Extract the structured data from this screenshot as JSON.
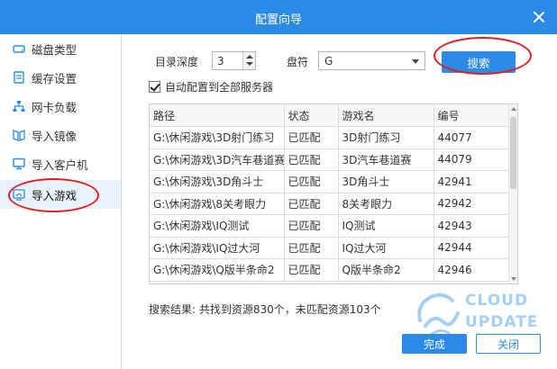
{
  "window": {
    "title": "配置向导"
  },
  "sidebar": {
    "items": [
      {
        "label": "磁盘类型",
        "icon": "disk-icon"
      },
      {
        "label": "缓存设置",
        "icon": "cache-icon"
      },
      {
        "label": "网卡负载",
        "icon": "network-icon"
      },
      {
        "label": "导入镜像",
        "icon": "mirror-icon"
      },
      {
        "label": "导入客户机",
        "icon": "monitor-icon"
      },
      {
        "label": "导入游戏",
        "icon": "game-icon",
        "active": true
      }
    ]
  },
  "form": {
    "depth_label": "目录深度",
    "depth_value": "3",
    "drive_label": "盘符",
    "drive_value": "G",
    "search_button": "搜索",
    "auto_config_label": "自动配置到全部服务器",
    "auto_config_checked": true
  },
  "table": {
    "headers": [
      "路径",
      "状态",
      "游戏名",
      "编号"
    ],
    "rows": [
      [
        "G:\\休闲游戏\\3D射门练习",
        "已匹配",
        "3D射门练习",
        "44077"
      ],
      [
        "G:\\休闲游戏\\3D汽车巷道赛",
        "已匹配",
        "3D汽车巷道赛",
        "44079"
      ],
      [
        "G:\\休闲游戏\\3D角斗士",
        "已匹配",
        "3D角斗士",
        "42941"
      ],
      [
        "G:\\休闲游戏\\8关考眼力",
        "已匹配",
        "8关考眼力",
        "42942"
      ],
      [
        "G:\\休闲游戏\\IQ测试",
        "已匹配",
        "IQ测试",
        "42943"
      ],
      [
        "G:\\休闲游戏\\IQ过大河",
        "已匹配",
        "IQ过大河",
        "42944"
      ],
      [
        "G:\\休闲游戏\\Q版半条命2",
        "已匹配",
        "Q版半条命2",
        "42946"
      ]
    ]
  },
  "result_text": "搜索结果: 共找到资源830个，未匹配资源103个",
  "buttons": {
    "done": "完成",
    "close": "关闭"
  },
  "watermark": {
    "line1": "CLOUD",
    "line2": "UPDATE"
  },
  "colors": {
    "accent": "#2b8ae6",
    "annotation": "#e02020"
  }
}
